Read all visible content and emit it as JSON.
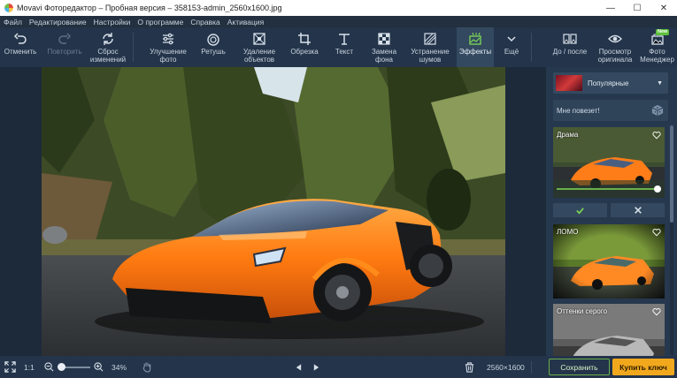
{
  "window": {
    "title": "Movavi Фоторедактор – Пробная версия – 358153-admin_2560x1600.jpg",
    "minimize": "—",
    "maximize": "☐",
    "close": "✕"
  },
  "menu": [
    "Файл",
    "Редактирование",
    "Настройки",
    "О программе",
    "Справка",
    "Активация"
  ],
  "toolbar": {
    "undo": "Отменить",
    "redo": "Повторить",
    "reset": "Сброс\nизменений",
    "enhance": "Улучшение\nфото",
    "retouch": "Ретушь",
    "remove_objects": "Удаление\nобъектов",
    "crop": "Обрезка",
    "text": "Текст",
    "bg_replace": "Замена\nфона",
    "denoise": "Устранение\nшумов",
    "effects": "Эффекты",
    "more": "Ещё",
    "before_after": "До / после",
    "view_original": "Просмотр\nоригинала",
    "photo_manager": "Фото\nМенеджер",
    "new_badge": "New"
  },
  "panel": {
    "preset_selected": "Популярные",
    "lucky_label": "Мне повезет!",
    "effects": [
      {
        "title": "Драма",
        "intensity": 1.0
      },
      {
        "title": "ЛОМО"
      },
      {
        "title": "Оттенки серого"
      }
    ],
    "scroll_position": 0.0
  },
  "bottom": {
    "fit_label": "1:1",
    "zoom_value": "34%",
    "zoom_level": 0.34,
    "image_size": "2560×1600",
    "save_label": "Сохранить",
    "buy_label": "Купить ключ"
  },
  "colors": {
    "toolbar_bg": "#24344a",
    "accent_green": "#6ab04c",
    "buy_orange": "#f2a81d",
    "car_orange": "#ff7a10"
  }
}
